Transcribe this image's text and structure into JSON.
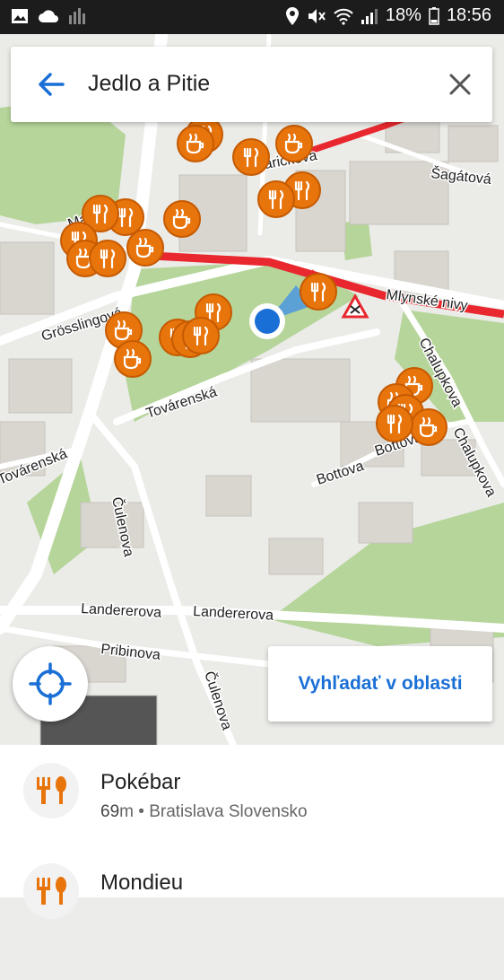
{
  "status_bar": {
    "battery_percent": "18%",
    "time": "18:56",
    "icons": [
      "image-icon",
      "cloud-icon",
      "signal-bars-icon",
      "location-pin-icon",
      "mute-icon",
      "wifi-icon",
      "cell-signal-icon",
      "battery-icon"
    ]
  },
  "search": {
    "title": "Jedlo a Pitie"
  },
  "map": {
    "street_labels": {
      "maly_trh": "Malý trh",
      "parickova": "Páričkova",
      "sagatova": "Šagátová",
      "mlynske_nivy": "Mlynské nivy",
      "grosslingova": "Grösslingová",
      "tovarenska": "Továrenská",
      "tovarenska2": "Továrenská",
      "chalupkova": "Chalupkova",
      "chalupkova2": "Chalupkova",
      "bottova": "Bottova",
      "bottova2": "Bottova",
      "culenova": "Čulenova",
      "culenova2": "Čulenova",
      "landererova": "Landererova",
      "landererova2": "Landererova",
      "pribinova": "Pribinova"
    }
  },
  "buttons": {
    "search_area": "Vyhľadať v oblasti"
  },
  "results": [
    {
      "name": "Pokébar",
      "distance": "69",
      "unit": "m",
      "location": "Bratislava Slovensko",
      "icon": "restaurant-icon"
    },
    {
      "name": "Mondieu",
      "icon": "restaurant-icon"
    }
  ],
  "colors": {
    "accent": "#1a6fd6",
    "poi_orange": "#e8740c",
    "traffic_red": "#e8282e",
    "park_green": "#b6d59a"
  }
}
